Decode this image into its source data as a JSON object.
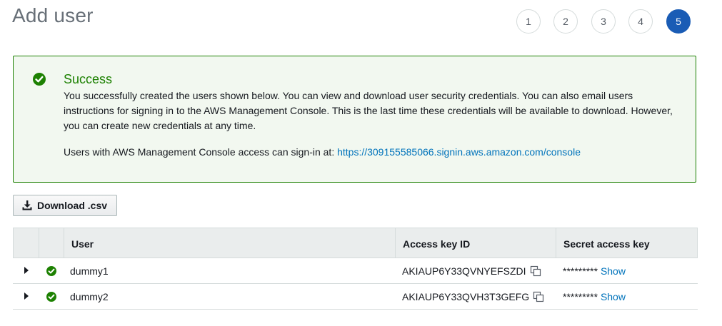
{
  "page": {
    "title": "Add user"
  },
  "steps": [
    "1",
    "2",
    "3",
    "4",
    "5"
  ],
  "active_step": "5",
  "alert": {
    "title": "Success",
    "body": "You successfully created the users shown below. You can view and download user security credentials. You can also email users instructions for signing in to the AWS Management Console. This is the last time these credentials will be available to download. However, you can create new credentials at any time.",
    "signin_prefix": "Users with AWS Management Console access can sign-in at: ",
    "signin_url": "https://309155585066.signin.aws.amazon.com/console",
    "color": "#1d8102"
  },
  "toolbar": {
    "download_label": "Download .csv"
  },
  "table": {
    "columns": [
      "",
      "",
      "User",
      "Access key ID",
      "Secret access key"
    ],
    "rows": [
      {
        "user": "dummy1",
        "access_key_id": "AKIAUP6Y33QVNYEFSZDI",
        "secret_masked": "*********",
        "show_label": "Show"
      },
      {
        "user": "dummy2",
        "access_key_id": "AKIAUP6Y33QVH3T3GEFG",
        "secret_masked": "*********",
        "show_label": "Show"
      }
    ]
  },
  "icons": {
    "alert": "success-check-icon",
    "download": "download-icon",
    "row_status": "success-check-icon",
    "copy": "copy-icon",
    "expand": "caret-right-icon"
  },
  "colors": {
    "accent": "#1a5cb5",
    "link": "#0073bb",
    "success": "#1d8102"
  }
}
